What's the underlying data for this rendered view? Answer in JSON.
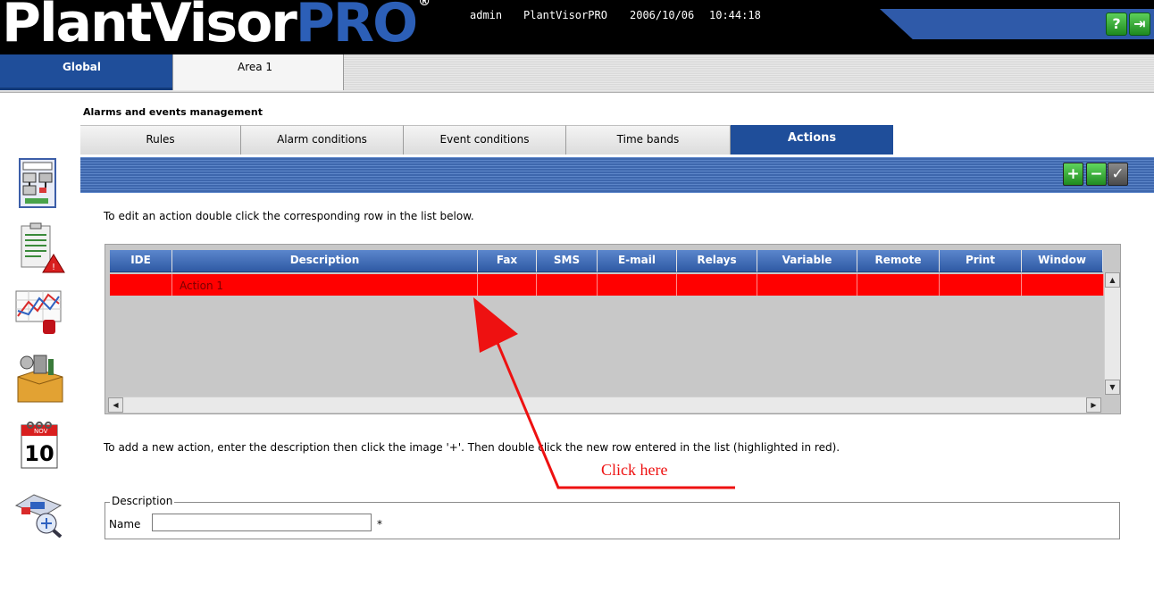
{
  "header": {
    "logo_text": "PlantVisor",
    "logo_pro": "PRO",
    "logo_reg": "®",
    "user": "admin",
    "site": "PlantVisorPRO",
    "date": "2006/10/06",
    "time": "10:44:18",
    "help_icon": "help-icon",
    "exit_icon": "exit-icon",
    "help_glyph": "?",
    "exit_glyph": "⇥"
  },
  "area_tabs": [
    {
      "label": "Global",
      "active": true
    },
    {
      "label": "Area 1",
      "active": false
    }
  ],
  "section_title": "Alarms and events management",
  "tabs": [
    {
      "label": "Rules"
    },
    {
      "label": "Alarm conditions"
    },
    {
      "label": "Event conditions"
    },
    {
      "label": "Time bands"
    },
    {
      "label": "Actions",
      "active": true
    }
  ],
  "toolbar": {
    "add_glyph": "+",
    "remove_glyph": "−",
    "save_glyph": "✓"
  },
  "instruction_top": "To edit an action double click the corresponding row in the list below.",
  "grid": {
    "columns": [
      "IDE",
      "Description",
      "Fax",
      "SMS",
      "E-mail",
      "Relays",
      "Variable",
      "Remote",
      "Print",
      "Window"
    ],
    "rows": [
      {
        "ide": "",
        "description": "Action 1",
        "fax": "",
        "sms": "",
        "email": "",
        "relays": "",
        "variable": "",
        "remote": "",
        "print": "",
        "window": ""
      }
    ],
    "scroll_up": "▲",
    "scroll_down": "▼",
    "scroll_left": "◀",
    "scroll_right": "▶"
  },
  "instruction_bottom": "To add a new action, enter the description then click the image '+'. Then double click the new row entered in the list (highlighted in red).",
  "annotation": {
    "text": "Click here",
    "color": "#ee1111"
  },
  "description_form": {
    "legend": "Description",
    "name_label": "Name",
    "name_value": "",
    "required_mark": "*"
  },
  "side_nav": [
    "device-map-icon",
    "alarms-list-icon",
    "graphs-icon",
    "tools-icon",
    "calendar-icon",
    "plant-config-icon"
  ],
  "calendar_icon": {
    "month": "NOV",
    "day": "10"
  },
  "colors": {
    "accent_blue": "#1f4e9a",
    "row_highlight": "#ff0000",
    "header_bg": "#000000"
  }
}
